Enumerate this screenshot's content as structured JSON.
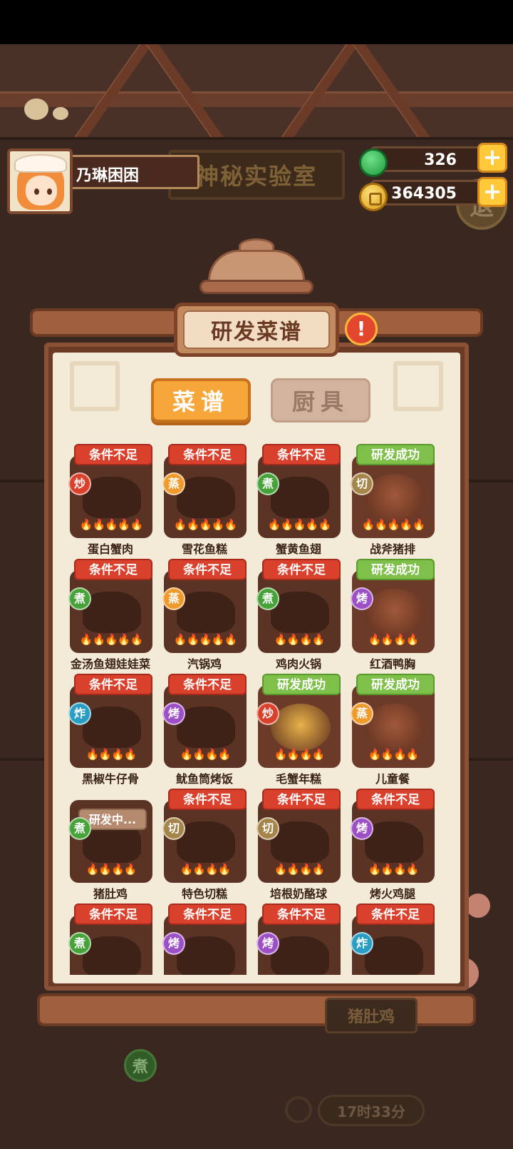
{
  "player": {
    "name": "乃琳困困"
  },
  "currency": {
    "jade": "326",
    "coins": "364305",
    "plus": "+"
  },
  "background": {
    "lab_title": "神秘实验室",
    "exit_label": "退",
    "current_dish": "猪肚鸡",
    "current_method": "煮",
    "timer": "17时33分"
  },
  "panel": {
    "title": "研发菜谱",
    "alert": "!",
    "tabs": [
      {
        "label": "菜谱",
        "active": true
      },
      {
        "label": "厨具",
        "active": false
      }
    ]
  },
  "recipes": [
    {
      "name": "蛋白蟹肉",
      "status": "条件不足",
      "method": "炒",
      "flames": 5
    },
    {
      "name": "雪花鱼糕",
      "status": "条件不足",
      "method": "蒸",
      "flames": 5
    },
    {
      "name": "蟹黄鱼翅",
      "status": "条件不足",
      "method": "煮",
      "flames": 5
    },
    {
      "name": "战斧猪排",
      "status": "研发成功",
      "method": "切",
      "flames": 5
    },
    {
      "name": "金汤鱼翅娃娃菜",
      "status": "条件不足",
      "method": "煮",
      "flames": 5
    },
    {
      "name": "汽锅鸡",
      "status": "条件不足",
      "method": "蒸",
      "flames": 5
    },
    {
      "name": "鸡肉火锅",
      "status": "条件不足",
      "method": "煮",
      "flames": 4
    },
    {
      "name": "红酒鸭胸",
      "status": "研发成功",
      "method": "烤",
      "flames": 4
    },
    {
      "name": "黑椒牛仔骨",
      "status": "条件不足",
      "method": "炸",
      "flames": 4
    },
    {
      "name": "鱿鱼筒烤饭",
      "status": "条件不足",
      "method": "烤",
      "flames": 4
    },
    {
      "name": "毛蟹年糕",
      "status": "研发成功",
      "method": "炒",
      "flames": 4
    },
    {
      "name": "儿童餐",
      "status": "研发成功",
      "method": "蒸",
      "flames": 4
    },
    {
      "name": "猪肚鸡",
      "status": "研发中...",
      "method": "煮",
      "flames": 4
    },
    {
      "name": "特色切糕",
      "status": "条件不足",
      "method": "切",
      "flames": 4
    },
    {
      "name": "培根奶酪球",
      "status": "条件不足",
      "method": "切",
      "flames": 4
    },
    {
      "name": "烤火鸡腿",
      "status": "条件不足",
      "method": "烤",
      "flames": 4
    },
    {
      "name": "",
      "status": "条件不足",
      "method": "煮",
      "flames": 0
    },
    {
      "name": "",
      "status": "条件不足",
      "method": "烤",
      "flames": 0
    },
    {
      "name": "",
      "status": "条件不足",
      "method": "烤",
      "flames": 0
    },
    {
      "name": "",
      "status": "条件不足",
      "method": "炸",
      "flames": 0
    }
  ],
  "colors": {
    "bad": "#d9412d",
    "good": "#7fc04a",
    "tab_active": "#f7a63a",
    "paper": "#f4ead8"
  }
}
